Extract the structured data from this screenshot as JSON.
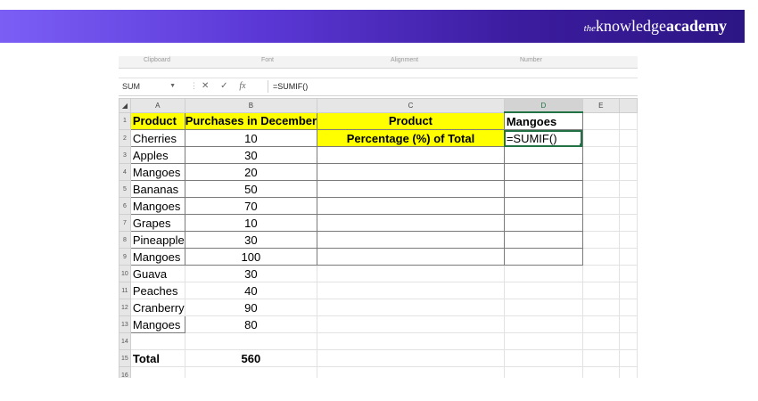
{
  "brand": {
    "the": "the",
    "knowledge": "knowledge",
    "academy": "academy"
  },
  "ribbon": {
    "groups": [
      "Clipboard",
      "Font",
      "Alignment",
      "Number"
    ]
  },
  "formula_bar": {
    "name_box": "SUM",
    "cancel_icon": "✕",
    "enter_icon": "✓",
    "fx_label": "fx",
    "formula": "=SUMIF()"
  },
  "columns": [
    "A",
    "B",
    "C",
    "D",
    "E"
  ],
  "selected_column": "D",
  "rows": [
    {
      "n": "1",
      "a": "Product",
      "b": "Purchases in December",
      "c": "Product",
      "d": "Mangoes"
    },
    {
      "n": "2",
      "a": "Cherries",
      "b": "10",
      "c": "Percentage (%) of Total",
      "d": "=SUMIF()"
    },
    {
      "n": "3",
      "a": "Apples",
      "b": "30",
      "c": "",
      "d": ""
    },
    {
      "n": "4",
      "a": "Mangoes",
      "b": "20",
      "c": "",
      "d": ""
    },
    {
      "n": "5",
      "a": "Bananas",
      "b": "50",
      "c": "",
      "d": ""
    },
    {
      "n": "6",
      "a": "Mangoes",
      "b": "70",
      "c": "",
      "d": ""
    },
    {
      "n": "7",
      "a": "Grapes",
      "b": "10",
      "c": "",
      "d": ""
    },
    {
      "n": "8",
      "a": "Pineapple",
      "b": "30",
      "c": "",
      "d": ""
    },
    {
      "n": "9",
      "a": "Mangoes",
      "b": "100",
      "c": "",
      "d": ""
    },
    {
      "n": "10",
      "a": "Guava",
      "b": "30",
      "c": "",
      "d": ""
    },
    {
      "n": "11",
      "a": "Peaches",
      "b": "40",
      "c": "",
      "d": ""
    },
    {
      "n": "12",
      "a": "Cranberry",
      "b": "90",
      "c": "",
      "d": ""
    },
    {
      "n": "13",
      "a": "Mangoes",
      "b": "80",
      "c": "",
      "d": ""
    },
    {
      "n": "14",
      "a": "",
      "b": "",
      "c": "",
      "d": ""
    },
    {
      "n": "15",
      "a": "Total",
      "b": "560",
      "c": "",
      "d": ""
    },
    {
      "n": "16",
      "a": "",
      "b": "",
      "c": "",
      "d": ""
    }
  ],
  "colors": {
    "highlight": "#ffff00",
    "active_cell": "#217346",
    "banner_start": "#7b5ff5",
    "banner_end": "#2c1584"
  }
}
